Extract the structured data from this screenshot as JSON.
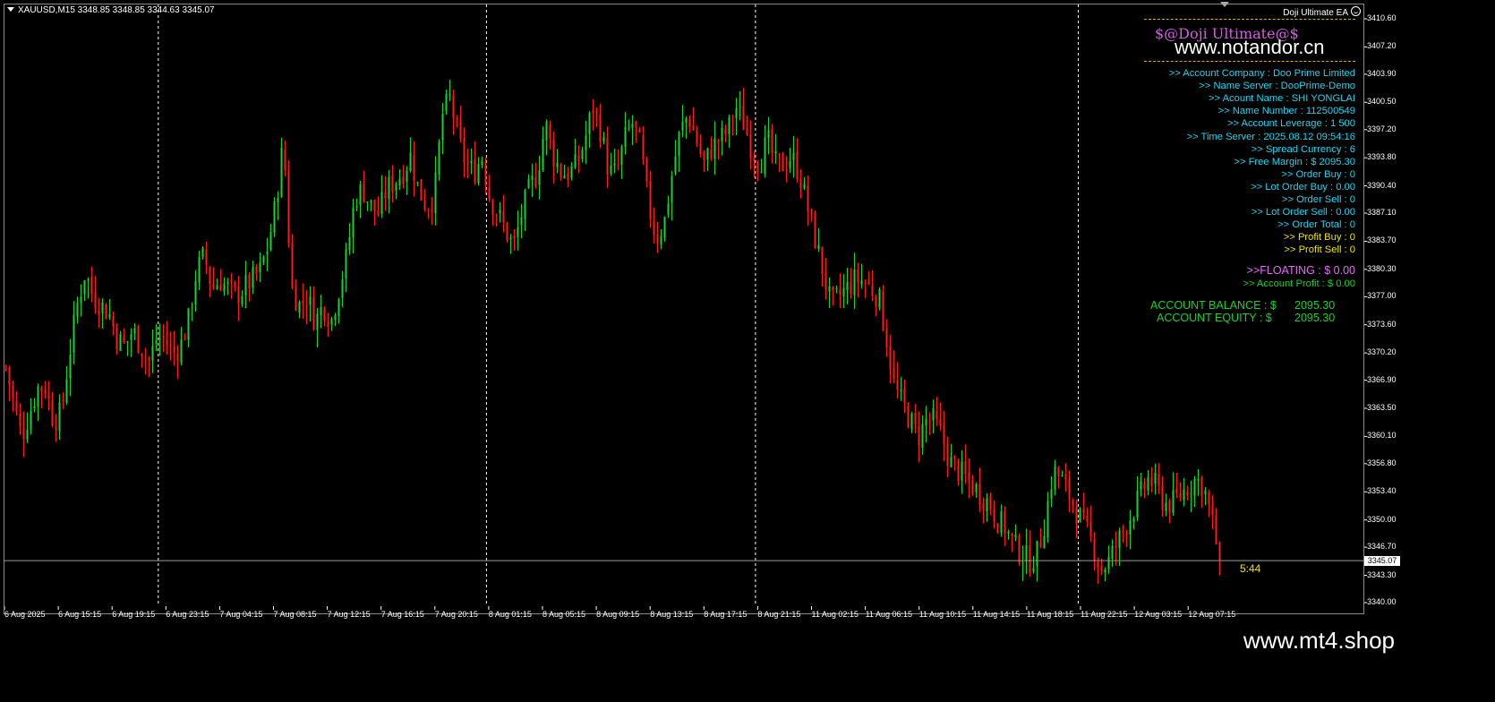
{
  "header": {
    "symbol_info": "XAUUSD,M15  3348.85 3348.85 3344.63 3345.07",
    "ea_label": "Doji Ultimate EA"
  },
  "panel": {
    "title": "$@Doji Ultimate@$",
    "watermark": "www.notandor.cn",
    "rows": [
      {
        "text": ">> Account Company  : Doo Prime Limited",
        "color": "cyan"
      },
      {
        "text": ">> Name Server  : DooPrime-Demo",
        "color": "cyan"
      },
      {
        "text": ">> Acount Name  : SHI YONGLAI",
        "color": "cyan"
      },
      {
        "text": ">> Name Number  : 112500549",
        "color": "cyan"
      },
      {
        "text": ">> Account Leverage  : 1 500",
        "color": "cyan"
      },
      {
        "text": ">> Time Server  : 2025.08.12 09:54:16",
        "color": "cyan"
      },
      {
        "text": ">> Spread Currency  : 6",
        "color": "cyan"
      },
      {
        "text": ">> Free Margin  : $ 2095.30",
        "color": "cyan"
      },
      {
        "text": ">> Order Buy  : 0",
        "color": "cyan"
      },
      {
        "text": ">> Lot Order Buy  : 0.00",
        "color": "cyan"
      },
      {
        "text": ">> Order Sell  : 0",
        "color": "cyan"
      },
      {
        "text": ">> Lot Order Sell  : 0.00",
        "color": "cyan"
      },
      {
        "text": ">> Order Total  : 0",
        "color": "cyan"
      },
      {
        "text": ">> Profit Buy  : 0",
        "color": "gold"
      },
      {
        "text": ">> Profit Sell  : 0",
        "color": "gold"
      }
    ],
    "floating": ">>FLOATING  : $ 0.00",
    "account_profit": ">> Account Profit  : $ 0.00",
    "balance_label": "ACCOUNT BALANCE  :   $",
    "balance_value": "2095.30",
    "equity_label": "ACCOUNT EQUITY   :   $",
    "equity_value": "2095.30"
  },
  "countdown": "5:44",
  "footer_watermark": "www.mt4.shop",
  "colors": {
    "bull": "#19d12f",
    "bear": "#ff1a1a",
    "background": "#000000",
    "grid_separator": "#ffffff",
    "current_price_line": "#9a9a9a"
  },
  "chart_data": {
    "type": "candlestick",
    "symbol": "XAUUSD",
    "timeframe": "M15",
    "current_price": 3345.07,
    "ylim": [
      3339.0,
      3412.0
    ],
    "y_ticks": [
      "3410.60",
      "3407.20",
      "3403.90",
      "3400.50",
      "3397.20",
      "3393.80",
      "3390.40",
      "3387.10",
      "3383.70",
      "3380.30",
      "3377.00",
      "3373.60",
      "3370.20",
      "3366.90",
      "3363.50",
      "3360.10",
      "3356.80",
      "3353.40",
      "3350.00",
      "3346.70",
      "3343.30",
      "3340.00"
    ],
    "x_ticks": [
      "6 Aug 2025",
      "6 Aug 15:15",
      "6 Aug 19:15",
      "6 Aug 23:15",
      "7 Aug 04:15",
      "7 Aug 08:15",
      "7 Aug 12:15",
      "7 Aug 16:15",
      "7 Aug 20:15",
      "8 Aug 01:15",
      "8 Aug 05:15",
      "8 Aug 09:15",
      "8 Aug 13:15",
      "8 Aug 17:15",
      "8 Aug 21:15",
      "11 Aug 02:15",
      "11 Aug 06:15",
      "11 Aug 10:15",
      "11 Aug 14:15",
      "11 Aug 18:15",
      "11 Aug 22:15",
      "12 Aug 03:15",
      "12 Aug 07:15"
    ],
    "day_separators": [
      "6 Aug 23:15",
      "8 Aug 01:15",
      "8 Aug 21:15",
      "11 Aug 22:15"
    ],
    "close_path": [
      3368.5,
      3364,
      3360,
      3363,
      3366,
      3366,
      3362,
      3363,
      3370,
      3376,
      3380,
      3377,
      3376,
      3375,
      3372,
      3371,
      3373,
      3371,
      3369,
      3372,
      3372,
      3370,
      3371,
      3374,
      3380,
      3382,
      3378,
      3379,
      3378,
      3377,
      3378,
      3379,
      3380,
      3383,
      3388,
      3396,
      3378,
      3376,
      3377,
      3374,
      3376,
      3374,
      3378,
      3382,
      3389,
      3390,
      3388,
      3387,
      3390,
      3391,
      3392,
      3394,
      3390,
      3388,
      3389,
      3399,
      3401,
      3396,
      3393,
      3392,
      3394,
      3389,
      3387,
      3385,
      3383,
      3387,
      3390,
      3392,
      3398,
      3394,
      3392,
      3392,
      3393,
      3396,
      3400,
      3397,
      3392,
      3392,
      3396,
      3398,
      3395,
      3388,
      3384,
      3386,
      3392,
      3397,
      3399,
      3396,
      3393,
      3395,
      3396,
      3397,
      3400,
      3398,
      3395,
      3393,
      3396,
      3393,
      3393,
      3394,
      3392,
      3388,
      3384,
      3380,
      3376,
      3377,
      3378,
      3379,
      3379,
      3378,
      3377,
      3372,
      3366,
      3364,
      3362,
      3360,
      3362,
      3362,
      3360,
      3357,
      3356,
      3355,
      3354,
      3353,
      3352,
      3350,
      3349,
      3347,
      3346,
      3345,
      3346,
      3350,
      3356,
      3355,
      3353,
      3351,
      3349,
      3347,
      3344,
      3345,
      3347,
      3349,
      3351,
      3353,
      3355,
      3354,
      3352,
      3352,
      3353,
      3354,
      3355,
      3354,
      3350,
      3345.07
    ]
  }
}
